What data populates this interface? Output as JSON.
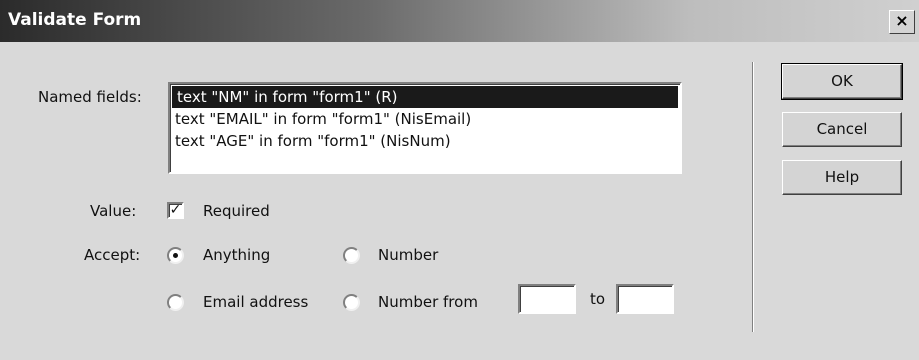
{
  "window": {
    "title": "Validate Form",
    "close_glyph": "×"
  },
  "named_fields": {
    "label": "Named fields:",
    "items": [
      "text \"NM\" in form \"form1\" (R)",
      "text \"EMAIL\" in form \"form1\" (NisEmail)",
      "text \"AGE\" in form \"form1\" (NisNum)"
    ],
    "selected_index": 0
  },
  "value": {
    "label": "Value:",
    "required_label": "Required",
    "required_checked": true
  },
  "accept": {
    "label": "Accept:",
    "options": {
      "anything": "Anything",
      "number": "Number",
      "email": "Email address",
      "number_from": "Number from"
    },
    "selected": "anything",
    "to_label": "to",
    "from_value": "",
    "to_value": ""
  },
  "buttons": {
    "ok": "OK",
    "cancel": "Cancel",
    "help": "Help"
  }
}
